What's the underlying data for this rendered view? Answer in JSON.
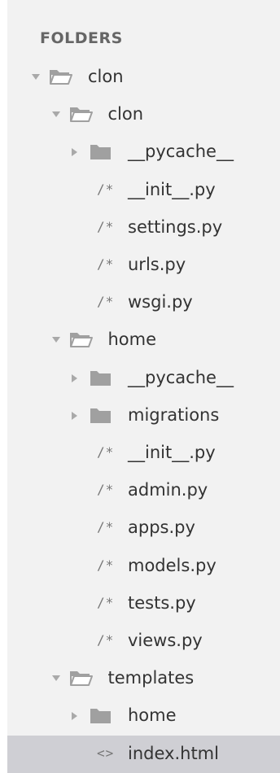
{
  "sidebar": {
    "header": "FOLDERS",
    "colors": {
      "background": "#f2f2f2",
      "selected": "#cfcfd4",
      "folder": "#a0a0a0",
      "text": "#333333"
    },
    "items": [
      {
        "label": "clon",
        "type": "folder",
        "expanded": true,
        "icon": "folder-open-icon",
        "depth": 0
      },
      {
        "label": "clon",
        "type": "folder",
        "expanded": true,
        "icon": "folder-open-icon",
        "depth": 1
      },
      {
        "label": "__pycache__",
        "type": "folder",
        "expanded": false,
        "icon": "folder-closed-icon",
        "depth": 2
      },
      {
        "label": "__init__.py",
        "type": "file",
        "glyph": "/*",
        "icon": "comment-file-icon",
        "depth": 2
      },
      {
        "label": "settings.py",
        "type": "file",
        "glyph": "/*",
        "icon": "comment-file-icon",
        "depth": 2
      },
      {
        "label": "urls.py",
        "type": "file",
        "glyph": "/*",
        "icon": "comment-file-icon",
        "depth": 2
      },
      {
        "label": "wsgi.py",
        "type": "file",
        "glyph": "/*",
        "icon": "comment-file-icon",
        "depth": 2
      },
      {
        "label": "home",
        "type": "folder",
        "expanded": true,
        "icon": "folder-open-icon",
        "depth": 1
      },
      {
        "label": "__pycache__",
        "type": "folder",
        "expanded": false,
        "icon": "folder-closed-icon",
        "depth": 2
      },
      {
        "label": "migrations",
        "type": "folder",
        "expanded": false,
        "icon": "folder-closed-icon",
        "depth": 2
      },
      {
        "label": "__init__.py",
        "type": "file",
        "glyph": "/*",
        "icon": "comment-file-icon",
        "depth": 2
      },
      {
        "label": "admin.py",
        "type": "file",
        "glyph": "/*",
        "icon": "comment-file-icon",
        "depth": 2
      },
      {
        "label": "apps.py",
        "type": "file",
        "glyph": "/*",
        "icon": "comment-file-icon",
        "depth": 2
      },
      {
        "label": "models.py",
        "type": "file",
        "glyph": "/*",
        "icon": "comment-file-icon",
        "depth": 2
      },
      {
        "label": "tests.py",
        "type": "file",
        "glyph": "/*",
        "icon": "comment-file-icon",
        "depth": 2
      },
      {
        "label": "views.py",
        "type": "file",
        "glyph": "/*",
        "icon": "comment-file-icon",
        "depth": 2
      },
      {
        "label": "templates",
        "type": "folder",
        "expanded": true,
        "icon": "folder-open-icon",
        "depth": 1
      },
      {
        "label": "home",
        "type": "folder",
        "expanded": false,
        "icon": "folder-closed-icon",
        "depth": 2
      },
      {
        "label": "index.html",
        "type": "file",
        "glyph": "<>",
        "icon": "html-file-icon",
        "depth": 2,
        "selected": true
      }
    ]
  }
}
